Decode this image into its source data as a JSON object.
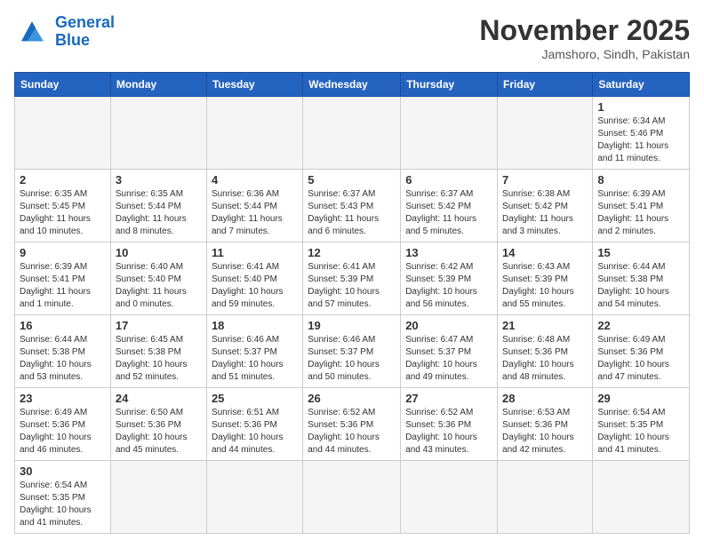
{
  "logo": {
    "general": "General",
    "blue": "Blue"
  },
  "title": "November 2025",
  "location": "Jamshoro, Sindh, Pakistan",
  "weekdays": [
    "Sunday",
    "Monday",
    "Tuesday",
    "Wednesday",
    "Thursday",
    "Friday",
    "Saturday"
  ],
  "weeks": [
    [
      {
        "day": "",
        "info": ""
      },
      {
        "day": "",
        "info": ""
      },
      {
        "day": "",
        "info": ""
      },
      {
        "day": "",
        "info": ""
      },
      {
        "day": "",
        "info": ""
      },
      {
        "day": "",
        "info": ""
      },
      {
        "day": "1",
        "info": "Sunrise: 6:34 AM\nSunset: 5:46 PM\nDaylight: 11 hours and 11 minutes."
      }
    ],
    [
      {
        "day": "2",
        "info": "Sunrise: 6:35 AM\nSunset: 5:45 PM\nDaylight: 11 hours and 10 minutes."
      },
      {
        "day": "3",
        "info": "Sunrise: 6:35 AM\nSunset: 5:44 PM\nDaylight: 11 hours and 8 minutes."
      },
      {
        "day": "4",
        "info": "Sunrise: 6:36 AM\nSunset: 5:44 PM\nDaylight: 11 hours and 7 minutes."
      },
      {
        "day": "5",
        "info": "Sunrise: 6:37 AM\nSunset: 5:43 PM\nDaylight: 11 hours and 6 minutes."
      },
      {
        "day": "6",
        "info": "Sunrise: 6:37 AM\nSunset: 5:42 PM\nDaylight: 11 hours and 5 minutes."
      },
      {
        "day": "7",
        "info": "Sunrise: 6:38 AM\nSunset: 5:42 PM\nDaylight: 11 hours and 3 minutes."
      },
      {
        "day": "8",
        "info": "Sunrise: 6:39 AM\nSunset: 5:41 PM\nDaylight: 11 hours and 2 minutes."
      }
    ],
    [
      {
        "day": "9",
        "info": "Sunrise: 6:39 AM\nSunset: 5:41 PM\nDaylight: 11 hours and 1 minute."
      },
      {
        "day": "10",
        "info": "Sunrise: 6:40 AM\nSunset: 5:40 PM\nDaylight: 11 hours and 0 minutes."
      },
      {
        "day": "11",
        "info": "Sunrise: 6:41 AM\nSunset: 5:40 PM\nDaylight: 10 hours and 59 minutes."
      },
      {
        "day": "12",
        "info": "Sunrise: 6:41 AM\nSunset: 5:39 PM\nDaylight: 10 hours and 57 minutes."
      },
      {
        "day": "13",
        "info": "Sunrise: 6:42 AM\nSunset: 5:39 PM\nDaylight: 10 hours and 56 minutes."
      },
      {
        "day": "14",
        "info": "Sunrise: 6:43 AM\nSunset: 5:39 PM\nDaylight: 10 hours and 55 minutes."
      },
      {
        "day": "15",
        "info": "Sunrise: 6:44 AM\nSunset: 5:38 PM\nDaylight: 10 hours and 54 minutes."
      }
    ],
    [
      {
        "day": "16",
        "info": "Sunrise: 6:44 AM\nSunset: 5:38 PM\nDaylight: 10 hours and 53 minutes."
      },
      {
        "day": "17",
        "info": "Sunrise: 6:45 AM\nSunset: 5:38 PM\nDaylight: 10 hours and 52 minutes."
      },
      {
        "day": "18",
        "info": "Sunrise: 6:46 AM\nSunset: 5:37 PM\nDaylight: 10 hours and 51 minutes."
      },
      {
        "day": "19",
        "info": "Sunrise: 6:46 AM\nSunset: 5:37 PM\nDaylight: 10 hours and 50 minutes."
      },
      {
        "day": "20",
        "info": "Sunrise: 6:47 AM\nSunset: 5:37 PM\nDaylight: 10 hours and 49 minutes."
      },
      {
        "day": "21",
        "info": "Sunrise: 6:48 AM\nSunset: 5:36 PM\nDaylight: 10 hours and 48 minutes."
      },
      {
        "day": "22",
        "info": "Sunrise: 6:49 AM\nSunset: 5:36 PM\nDaylight: 10 hours and 47 minutes."
      }
    ],
    [
      {
        "day": "23",
        "info": "Sunrise: 6:49 AM\nSunset: 5:36 PM\nDaylight: 10 hours and 46 minutes."
      },
      {
        "day": "24",
        "info": "Sunrise: 6:50 AM\nSunset: 5:36 PM\nDaylight: 10 hours and 45 minutes."
      },
      {
        "day": "25",
        "info": "Sunrise: 6:51 AM\nSunset: 5:36 PM\nDaylight: 10 hours and 44 minutes."
      },
      {
        "day": "26",
        "info": "Sunrise: 6:52 AM\nSunset: 5:36 PM\nDaylight: 10 hours and 44 minutes."
      },
      {
        "day": "27",
        "info": "Sunrise: 6:52 AM\nSunset: 5:36 PM\nDaylight: 10 hours and 43 minutes."
      },
      {
        "day": "28",
        "info": "Sunrise: 6:53 AM\nSunset: 5:36 PM\nDaylight: 10 hours and 42 minutes."
      },
      {
        "day": "29",
        "info": "Sunrise: 6:54 AM\nSunset: 5:35 PM\nDaylight: 10 hours and 41 minutes."
      }
    ],
    [
      {
        "day": "30",
        "info": "Sunrise: 6:54 AM\nSunset: 5:35 PM\nDaylight: 10 hours and 41 minutes."
      },
      {
        "day": "",
        "info": ""
      },
      {
        "day": "",
        "info": ""
      },
      {
        "day": "",
        "info": ""
      },
      {
        "day": "",
        "info": ""
      },
      {
        "day": "",
        "info": ""
      },
      {
        "day": "",
        "info": ""
      }
    ]
  ]
}
